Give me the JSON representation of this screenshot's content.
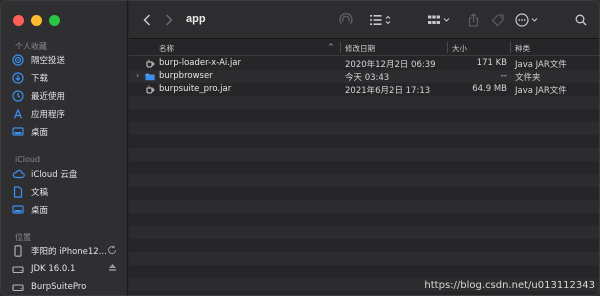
{
  "window": {
    "title": "app"
  },
  "sidebar": {
    "sections": [
      {
        "heading": "个人收藏",
        "items": [
          {
            "label": "隔空投送",
            "icon": "airdrop-icon"
          },
          {
            "label": "下载",
            "icon": "download-icon"
          },
          {
            "label": "最近使用",
            "icon": "clock-icon"
          },
          {
            "label": "应用程序",
            "icon": "applications-icon"
          },
          {
            "label": "桌面",
            "icon": "desktop-icon"
          }
        ]
      },
      {
        "heading": "iCloud",
        "items": [
          {
            "label": "iCloud 云盘",
            "icon": "cloud-icon"
          },
          {
            "label": "文稿",
            "icon": "document-icon"
          },
          {
            "label": "桌面",
            "icon": "desktop-icon"
          }
        ]
      },
      {
        "heading": "位置",
        "items": [
          {
            "label": "李阳的 iPhone12...",
            "icon": "phone-icon",
            "extra_icon": "sync-icon"
          },
          {
            "label": "JDK 16.0.1",
            "icon": "disk-icon",
            "extra_icon": "eject-icon"
          },
          {
            "label": "BurpSuitePro",
            "icon": "disk-icon"
          }
        ]
      }
    ]
  },
  "toolbar": {
    "back_icon": "chevron-left-icon",
    "forward_icon": "chevron-right-icon",
    "airdrop_icon": "airdrop-icon",
    "view_icon": "list-view-icon",
    "group_icon": "grid-group-icon",
    "share_icon": "share-icon",
    "tag_icon": "tag-icon",
    "more_icon": "ellipsis-icon",
    "search_icon": "search-icon"
  },
  "columns": {
    "name": "名称",
    "date": "修改日期",
    "size": "大小",
    "kind": "种类"
  },
  "files": [
    {
      "name": "burp-loader-x-Ai.jar",
      "date": "2020年12月2日 06:39",
      "size": "171 KB",
      "kind": "Java JAR文件",
      "icon": "jar-icon",
      "folder": false
    },
    {
      "name": "burpbrowser",
      "date": "今天 03:43",
      "size": "--",
      "kind": "文件夹",
      "icon": "folder-icon",
      "folder": true
    },
    {
      "name": "burpsuite_pro.jar",
      "date": "2021年6月2日 17:13",
      "size": "64.9 MB",
      "kind": "Java JAR文件",
      "icon": "jar-icon",
      "folder": false
    }
  ],
  "watermark": "https://blog.csdn.net/u013112343",
  "colors": {
    "accent": "#3b8ff0",
    "close": "#ff5f57",
    "minimize": "#febc2e",
    "maximize": "#28c840"
  }
}
